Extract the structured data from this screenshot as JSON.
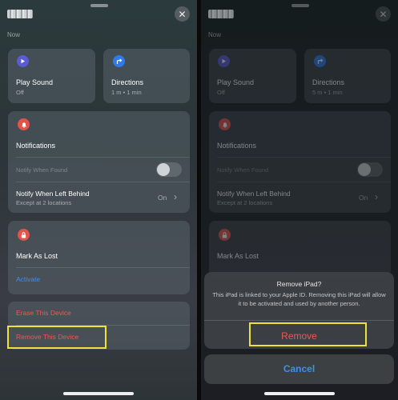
{
  "left": {
    "now_label": "Now",
    "close_icon": "close-icon",
    "play_sound": {
      "label": "Play Sound",
      "status": "Off"
    },
    "directions": {
      "label": "Directions",
      "status": "1 m • 1 min"
    },
    "notifications": {
      "title": "Notifications",
      "notify_when_found": "Notify When Found",
      "notify_left_behind": "Notify When Left Behind",
      "left_behind_sub": "Except at 2 locations",
      "left_behind_value": "On"
    },
    "mark_as_lost": {
      "title": "Mark As Lost",
      "action": "Activate"
    },
    "erase_device": "Erase This Device",
    "remove_device": "Remove This Device"
  },
  "right": {
    "now_label": "Now",
    "play_sound": {
      "label": "Play Sound",
      "status": "Off"
    },
    "directions": {
      "label": "Directions",
      "status": "5 m • 1 min"
    },
    "notifications": {
      "title": "Notifications",
      "notify_when_found": "Notify When Found",
      "notify_left_behind": "Notify When Left Behind",
      "left_behind_sub": "Except at 2 locations",
      "left_behind_value": "On"
    },
    "mark_as_lost": {
      "title": "Mark As Lost"
    },
    "dialog": {
      "title": "Remove iPad?",
      "message": "This iPad is linked to your Apple ID. Removing this iPad will allow it to be activated and used by another person.",
      "remove_label": "Remove",
      "cancel_label": "Cancel"
    }
  },
  "colors": {
    "accent_blue": "#3e8ef0",
    "destructive_red": "#ec5a50",
    "highlight_yellow": "#f0e13a"
  }
}
